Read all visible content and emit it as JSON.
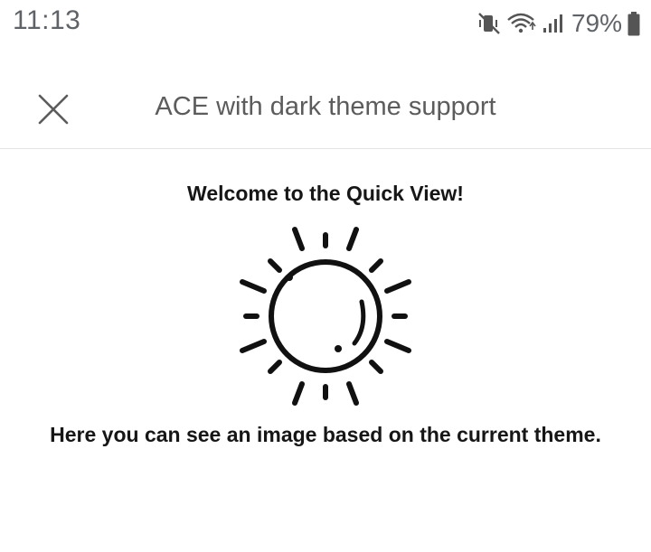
{
  "status_bar": {
    "time": "11:13",
    "battery_percent": "79%",
    "icons": [
      "vibrate-mute-icon",
      "wifi-icon",
      "signal-icon",
      "battery-icon"
    ]
  },
  "header": {
    "title": "ACE with dark theme support",
    "close_icon": "close-icon"
  },
  "quick_view": {
    "welcome_text": "Welcome to the Quick View!",
    "image_icon": "sun-icon",
    "description_text": "Here you can see an image based on the current theme."
  },
  "colors": {
    "background": "#ffffff",
    "status_text": "#5f6368",
    "header_text": "#5c5c5c",
    "body_text": "#161616",
    "divider": "#e4e4e4"
  }
}
